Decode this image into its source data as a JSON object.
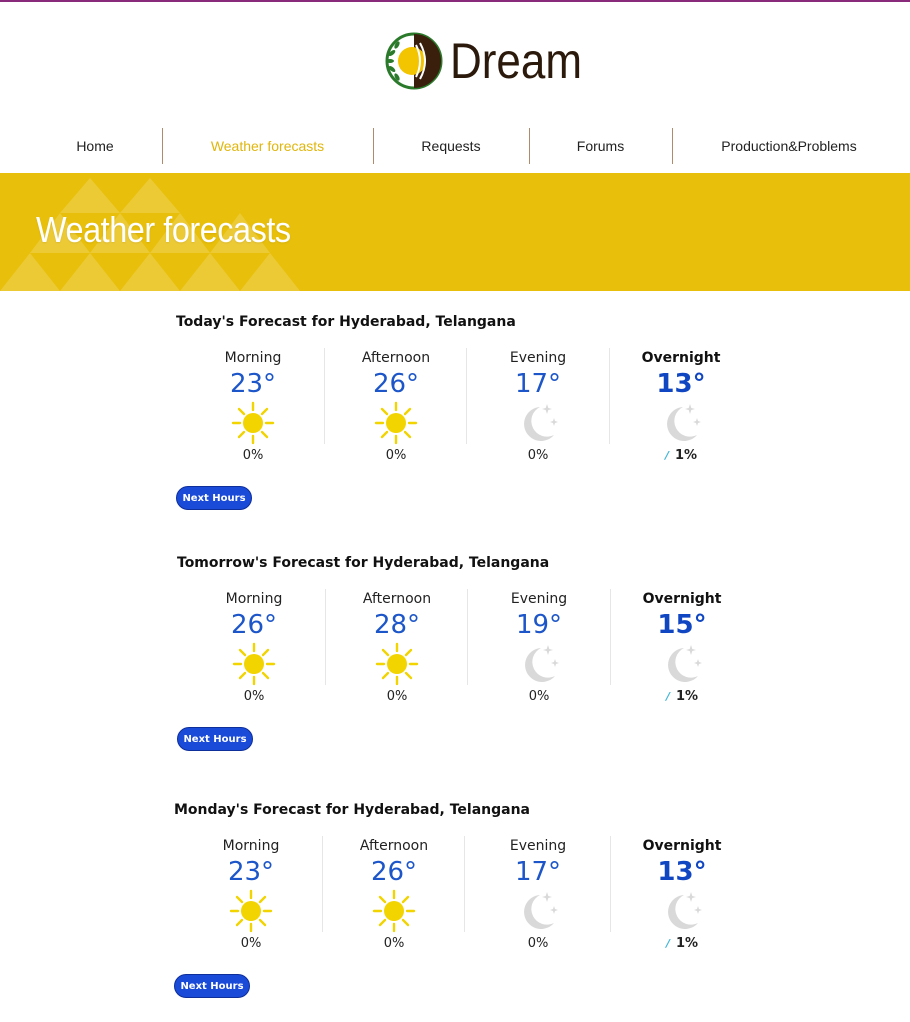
{
  "brand": {
    "name": "Dream"
  },
  "nav": {
    "items": [
      {
        "label": "Home"
      },
      {
        "label": "Weather forecasts"
      },
      {
        "label": "Requests"
      },
      {
        "label": "Forums"
      },
      {
        "label": "Production&Problems"
      }
    ],
    "active_index": 1
  },
  "banner": {
    "title": "Weather forecasts"
  },
  "colors": {
    "accent": "#e8bf0a",
    "temp_blue": "#1d56c9",
    "button_blue": "#1a4ad8",
    "sun": "#f2d400",
    "moon": "#d9d9d9"
  },
  "forecasts": [
    {
      "title": "Today's Forecast for Hyderabad, Telangana",
      "button": "Next Hours",
      "periods": [
        {
          "label": "Morning",
          "temp": "23°",
          "icon": "sun-icon",
          "precip": "0%"
        },
        {
          "label": "Afternoon",
          "temp": "26°",
          "icon": "sun-icon",
          "precip": "0%"
        },
        {
          "label": "Evening",
          "temp": "17°",
          "icon": "moon-icon",
          "precip": "0%"
        },
        {
          "label": "Overnight",
          "temp": "13°",
          "icon": "moon-icon",
          "precip": "1%"
        }
      ]
    },
    {
      "title": "Tomorrow's Forecast for Hyderabad, Telangana",
      "button": "Next Hours",
      "periods": [
        {
          "label": "Morning",
          "temp": "26°",
          "icon": "sun-icon",
          "precip": "0%"
        },
        {
          "label": "Afternoon",
          "temp": "28°",
          "icon": "sun-icon",
          "precip": "0%"
        },
        {
          "label": "Evening",
          "temp": "19°",
          "icon": "moon-icon",
          "precip": "0%"
        },
        {
          "label": "Overnight",
          "temp": "15°",
          "icon": "moon-icon",
          "precip": "1%"
        }
      ]
    },
    {
      "title": "Monday's Forecast for Hyderabad, Telangana",
      "button": "Next Hours",
      "periods": [
        {
          "label": "Morning",
          "temp": "23°",
          "icon": "sun-icon",
          "precip": "0%"
        },
        {
          "label": "Afternoon",
          "temp": "26°",
          "icon": "sun-icon",
          "precip": "0%"
        },
        {
          "label": "Evening",
          "temp": "17°",
          "icon": "moon-icon",
          "precip": "0%"
        },
        {
          "label": "Overnight",
          "temp": "13°",
          "icon": "moon-icon",
          "precip": "1%"
        }
      ]
    }
  ]
}
